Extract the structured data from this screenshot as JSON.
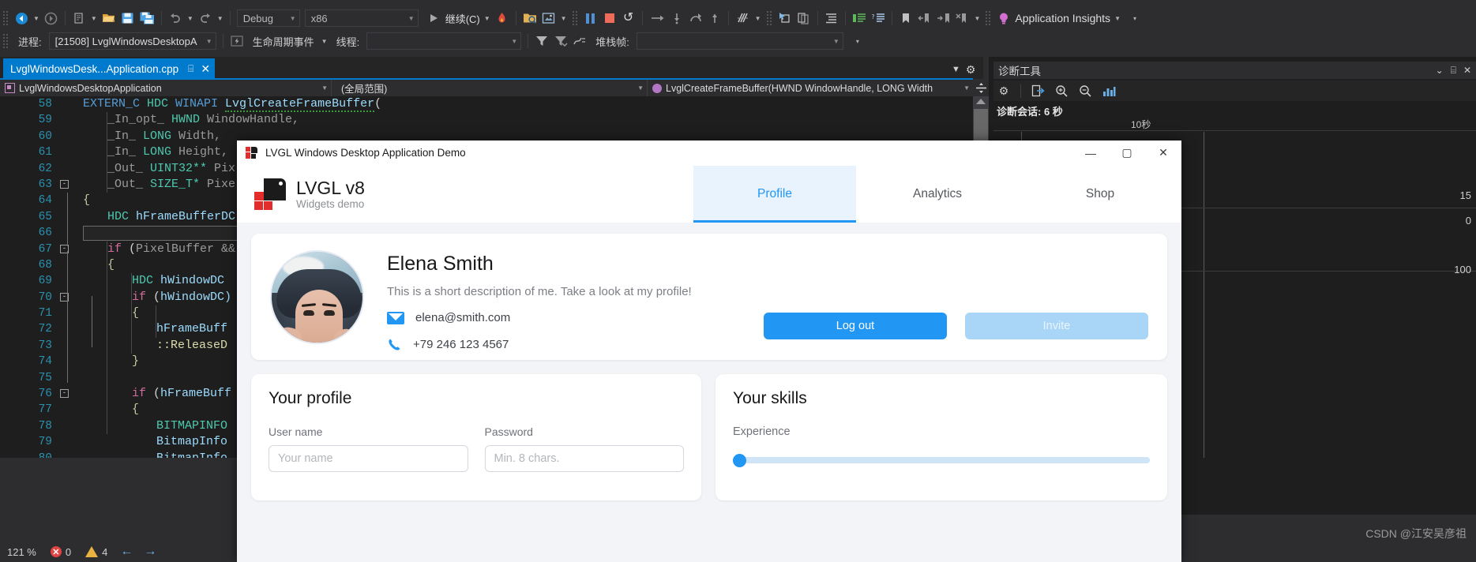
{
  "ide": {
    "toolbar": {
      "nav_back_icon": "back-arrow-icon",
      "nav_forward_icon": "forward-arrow-icon",
      "new_item_icon": "new-item-icon",
      "open_file_icon": "open-folder-icon",
      "save_icon": "save-icon",
      "save_all_icon": "save-all-icon",
      "undo_icon": "undo-icon",
      "redo_icon": "redo-icon",
      "config_value": "Debug",
      "platform_value": "x86",
      "continue_label": "继续(C)",
      "hot_reload_icon": "hot-reload-icon",
      "attach_icon": "attach-to-process-icon",
      "snapshot_icon": "snapshot-icon",
      "pause_icon": "pause-icon",
      "stop_icon": "stop-icon",
      "restart_icon": "restart-icon",
      "step_over_icon": "step-over-icon",
      "step_into_icon": "step-into-icon",
      "step_out_icon": "step-out-icon",
      "step_up_icon": "step-up-icon",
      "intellitrace_icon": "intellitrace-icon",
      "select_element_icon": "select-element-icon",
      "copy_icon": "copy-icon",
      "indent1_icon": "indent-icon",
      "indent2_icon": "comment-icon",
      "indent3_icon": "uncomment-icon",
      "bookmark_icon": "bookmark-icon",
      "prev_bookmark_icon": "previous-bookmark-icon",
      "next_bookmark_icon": "next-bookmark-icon",
      "clear_bookmark_icon": "clear-bookmark-icon",
      "insights_label": "Application Insights",
      "insights_icon": "lightbulb-icon"
    },
    "debug_row": {
      "process_label": "进程:",
      "process_value": "[21508] LvglWindowsDesktopA",
      "lifecycle_label": "生命周期事件",
      "thread_label": "线程:",
      "thread_value": "",
      "stackframe_label": "堆栈帧:",
      "stackframe_value": "",
      "filter_icon": "filter-icon",
      "flag_icon": "flag-icon",
      "thread_flag_icon": "thread-marker-icon"
    },
    "tab": {
      "title": "LvglWindowsDesk...Application.cpp",
      "pin_icon": "pin-icon",
      "close_icon": "close-icon",
      "dropdown_icon": "chevron-down-icon",
      "settings_icon": "gear-icon"
    },
    "navbar": {
      "project": "LvglWindowsDesktopApplication",
      "scope": "(全局范围)",
      "member": "LvglCreateFrameBuffer(HWND WindowHandle, LONG Width",
      "split_icon": "split-editor-icon"
    },
    "code_lines": [
      {
        "n": "58",
        "fold": "",
        "indent": 0,
        "tokens": [
          {
            "t": "EXTERN_C ",
            "c": "k-blue"
          },
          {
            "t": "HDC ",
            "c": "k-teal"
          },
          {
            "t": "WINAPI ",
            "c": "k-blue"
          },
          {
            "t": "LvglCreateFrameBuffer",
            "c": "k-lblue squig"
          },
          {
            "t": "(",
            "c": "k-plain"
          }
        ]
      },
      {
        "n": "59",
        "fold": "",
        "indent": 1,
        "tokens": [
          {
            "t": "_In_opt_ ",
            "c": "k-grey"
          },
          {
            "t": "HWND ",
            "c": "k-teal"
          },
          {
            "t": "WindowHandle,",
            "c": "k-grey"
          }
        ]
      },
      {
        "n": "60",
        "fold": "",
        "indent": 1,
        "tokens": [
          {
            "t": "_In_ ",
            "c": "k-grey"
          },
          {
            "t": "LONG ",
            "c": "k-teal"
          },
          {
            "t": "Width,",
            "c": "k-grey"
          }
        ]
      },
      {
        "n": "61",
        "fold": "",
        "indent": 1,
        "tokens": [
          {
            "t": "_In_ ",
            "c": "k-grey"
          },
          {
            "t": "LONG ",
            "c": "k-teal"
          },
          {
            "t": "Height,",
            "c": "k-grey"
          }
        ]
      },
      {
        "n": "62",
        "fold": "",
        "indent": 1,
        "tokens": [
          {
            "t": "_Out_ ",
            "c": "k-grey"
          },
          {
            "t": "UINT32** ",
            "c": "k-teal"
          },
          {
            "t": "Pix",
            "c": "k-grey"
          }
        ]
      },
      {
        "n": "63",
        "fold": "-",
        "indent": 1,
        "tokens": [
          {
            "t": "_Out_ ",
            "c": "k-grey"
          },
          {
            "t": "SIZE_T* ",
            "c": "k-teal"
          },
          {
            "t": "Pixe",
            "c": "k-grey"
          }
        ]
      },
      {
        "n": "64",
        "fold": "",
        "indent": 0,
        "tokens": [
          {
            "t": "{",
            "c": "k-brace"
          }
        ]
      },
      {
        "n": "65",
        "fold": "",
        "indent": 1,
        "tokens": [
          {
            "t": "HDC ",
            "c": "k-teal"
          },
          {
            "t": "hFrameBufferDC",
            "c": "k-lblue"
          }
        ]
      },
      {
        "n": "66",
        "fold": "",
        "indent": 1,
        "tokens": []
      },
      {
        "n": "67",
        "fold": "-",
        "indent": 1,
        "tokens": [
          {
            "t": "if ",
            "c": "k-pink"
          },
          {
            "t": "(",
            "c": "k-plain"
          },
          {
            "t": "PixelBuffer && ",
            "c": "k-grey"
          }
        ]
      },
      {
        "n": "68",
        "fold": "",
        "indent": 1,
        "tokens": [
          {
            "t": "{",
            "c": "k-brace"
          }
        ]
      },
      {
        "n": "69",
        "fold": "",
        "indent": 2,
        "tokens": [
          {
            "t": "HDC ",
            "c": "k-teal"
          },
          {
            "t": "hWindowDC",
            "c": "k-lblue"
          }
        ]
      },
      {
        "n": "70",
        "fold": "-",
        "indent": 2,
        "tokens": [
          {
            "t": "if ",
            "c": "k-pink"
          },
          {
            "t": "(",
            "c": "k-plain"
          },
          {
            "t": "hWindowDC)",
            "c": "k-lblue"
          }
        ]
      },
      {
        "n": "71",
        "fold": "",
        "indent": 2,
        "tokens": [
          {
            "t": "{",
            "c": "k-brace"
          }
        ]
      },
      {
        "n": "72",
        "fold": "",
        "indent": 3,
        "tokens": [
          {
            "t": "hFrameBuff",
            "c": "k-lblue"
          }
        ]
      },
      {
        "n": "73",
        "fold": "",
        "indent": 3,
        "tokens": [
          {
            "t": "::ReleaseD",
            "c": "k-yellow"
          }
        ]
      },
      {
        "n": "74",
        "fold": "",
        "indent": 2,
        "tokens": [
          {
            "t": "}",
            "c": "k-brace"
          }
        ]
      },
      {
        "n": "75",
        "fold": "",
        "indent": 2,
        "tokens": []
      },
      {
        "n": "76",
        "fold": "-",
        "indent": 2,
        "tokens": [
          {
            "t": "if ",
            "c": "k-pink"
          },
          {
            "t": "(",
            "c": "k-plain"
          },
          {
            "t": "hFrameBuff",
            "c": "k-lblue"
          }
        ]
      },
      {
        "n": "77",
        "fold": "",
        "indent": 2,
        "tokens": [
          {
            "t": "{",
            "c": "k-brace"
          }
        ]
      },
      {
        "n": "78",
        "fold": "",
        "indent": 3,
        "tokens": [
          {
            "t": "BITMAPINFO",
            "c": "k-teal"
          }
        ]
      },
      {
        "n": "79",
        "fold": "",
        "indent": 3,
        "tokens": [
          {
            "t": "BitmapInfo",
            "c": "k-lblue"
          }
        ]
      },
      {
        "n": "80",
        "fold": "",
        "indent": 3,
        "tokens": [
          {
            "t": "BitmapInfo",
            "c": "k-lblue"
          }
        ]
      }
    ],
    "diagnostics": {
      "title": "诊断工具",
      "close_icon": "close-icon",
      "settings_icon": "gear-icon",
      "export_icon": "export-icon",
      "zoom_in_icon": "zoom-in-icon",
      "zoom_out_icon": "zoom-out-icon",
      "chart_icon": "chart-icon",
      "session_label": "诊断会话: 6 秒",
      "ruler_ticks": [
        "10秒"
      ],
      "y_labels": [
        "15",
        "0",
        "100"
      ]
    },
    "statusbar": {
      "zoom": "121 %",
      "error_count": "0",
      "warning_count": "4",
      "prev_icon": "previous-error-icon",
      "next_icon": "next-error-icon"
    },
    "watermark": "CSDN @江安吴彦祖"
  },
  "lvgl": {
    "window_title": "LVGL Windows Desktop Application Demo",
    "favicon": "lvgl-favicon-icon",
    "minimize_label": "—",
    "maximize_label": "▢",
    "close_label": "✕",
    "brand": {
      "name": "LVGL v8",
      "subtitle": "Widgets demo",
      "logo_icon": "lvgl-logo-icon"
    },
    "tabs": [
      {
        "label": "Profile",
        "active": true
      },
      {
        "label": "Analytics",
        "active": false
      },
      {
        "label": "Shop",
        "active": false
      }
    ],
    "profile": {
      "avatar_icon": "user-avatar-image",
      "name": "Elena Smith",
      "description": "This is a short description of me. Take a look at my profile!",
      "email": "elena@smith.com",
      "email_icon": "mail-icon",
      "phone": "+79 246 123 4567",
      "phone_icon": "phone-icon",
      "logout_label": "Log out",
      "invite_label": "Invite"
    },
    "your_profile": {
      "title": "Your profile",
      "username_label": "User name",
      "username_value": "",
      "username_placeholder": "Your name",
      "password_label": "Password",
      "password_value": "",
      "password_placeholder": "Min. 8 chars."
    },
    "your_skills": {
      "title": "Your skills",
      "experience_label": "Experience",
      "experience_value": 0
    },
    "colors": {
      "accent": "#2196f3",
      "tab_active_bg": "#e8f3fd",
      "body_bg": "#f3f4f7",
      "brand_red": "#e32d2d"
    }
  }
}
